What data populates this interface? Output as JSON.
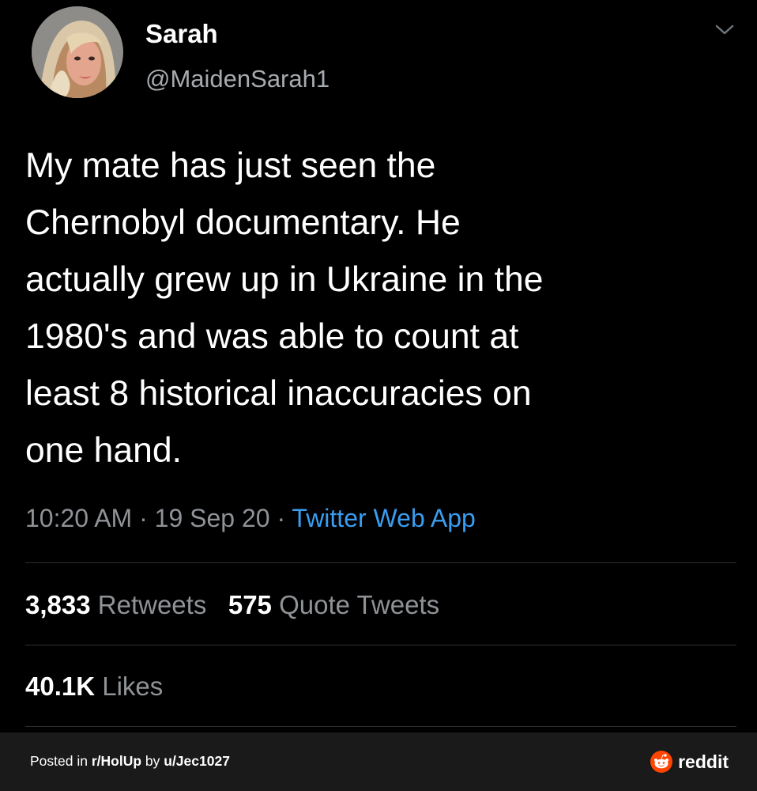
{
  "tweet": {
    "author": {
      "display_name": "Sarah",
      "handle": "@MaidenSarah1",
      "avatar": "profile-photo"
    },
    "menu_icon": "chevron-down-icon",
    "text_lines": [
      "My mate has just seen the",
      "Chernobyl documentary. He",
      "actually grew up in Ukraine in the",
      "1980's and was able to count at",
      "least 8 historical inaccuracies on",
      "one hand."
    ],
    "time": "10:20 AM",
    "date": "19 Sep 20",
    "separator": "·",
    "source": "Twitter Web App",
    "stats": {
      "retweets_count": "3,833",
      "retweets_label": "Retweets",
      "quotes_count": "575",
      "quotes_label": "Quote Tweets",
      "likes_count": "40.1K",
      "likes_label": "Likes"
    }
  },
  "footer": {
    "posted_prefix": "Posted in ",
    "subreddit": "r/HolUp",
    "by": " by ",
    "user": "u/Jec1027",
    "brand": "reddit",
    "brand_icon": "reddit-alien-icon"
  },
  "colors": {
    "background": "#000000",
    "text": "#ffffff",
    "secondary_text": "#8f9397",
    "link": "#3a9df0",
    "divider": "#2c2f33",
    "footer_bg": "#1a1a1b",
    "reddit_orange": "#ff4500"
  }
}
